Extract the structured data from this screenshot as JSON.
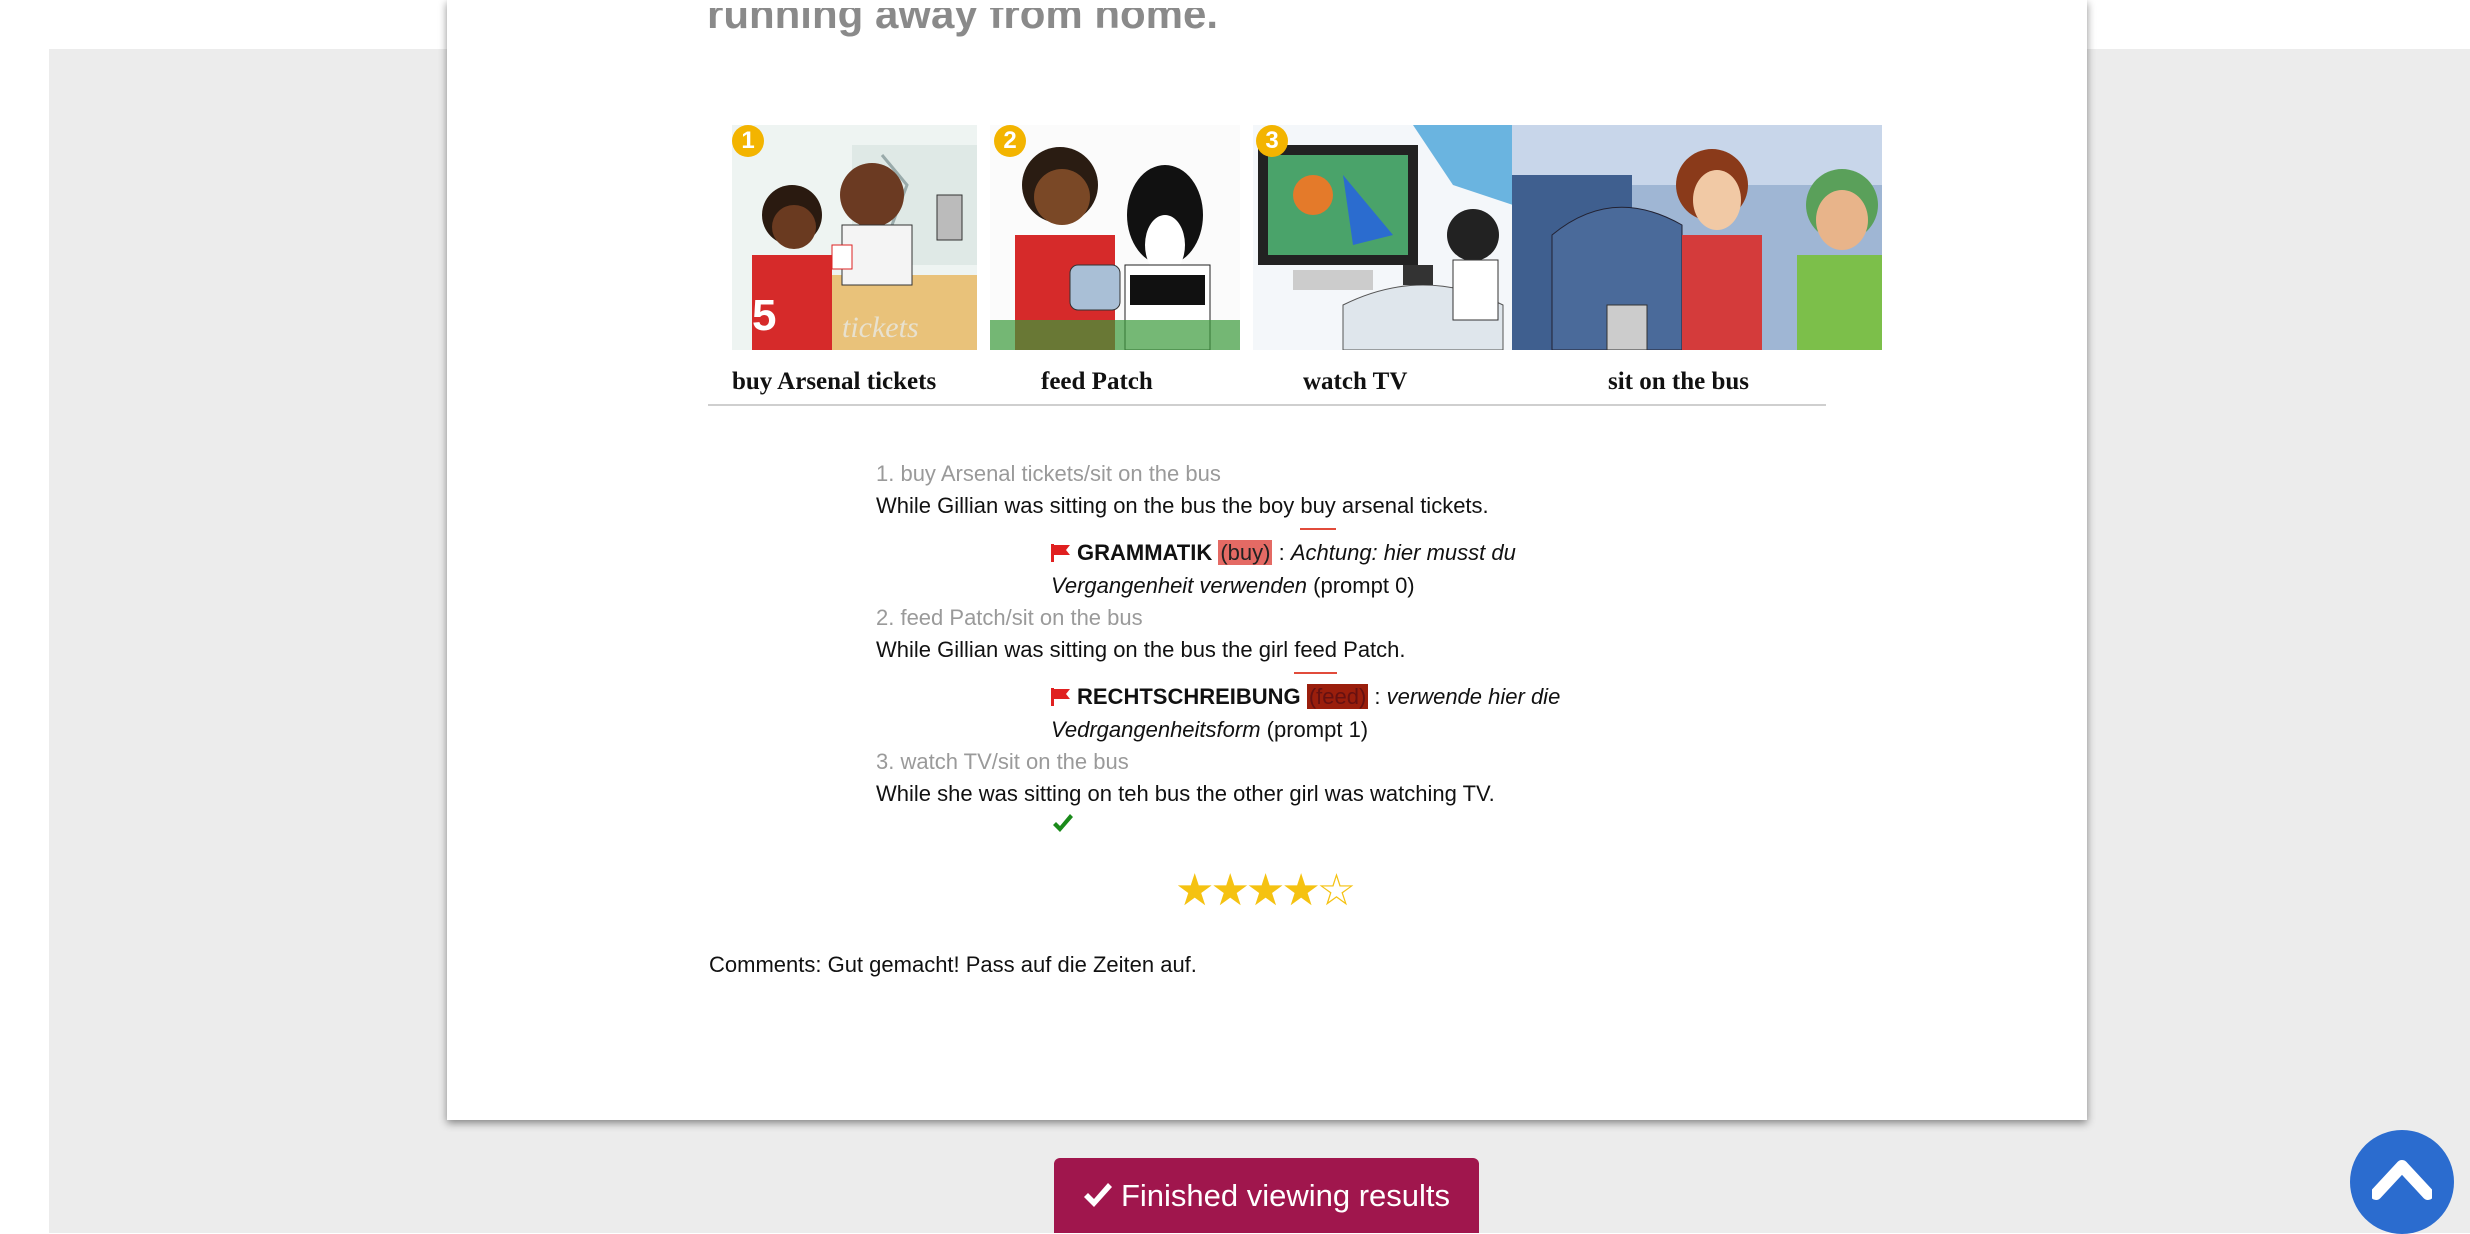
{
  "worksheet": {
    "cut_title": "running away from home."
  },
  "strip": {
    "panels": [
      {
        "number": "1",
        "caption": "buy Arsenal tickets",
        "icon": "ticket-counter-illustration"
      },
      {
        "number": "2",
        "caption": "feed Patch",
        "icon": "dog-feeding-illustration"
      },
      {
        "number": "3",
        "caption": "watch TV",
        "icon": "tv-watching-illustration"
      },
      {
        "number": "",
        "caption": "sit on the bus",
        "icon": "bus-passengers-illustration"
      }
    ]
  },
  "answers": [
    {
      "prompt": "1. buy Arsenal tickets/sit on the bus",
      "text_before": "While Gillian was sitting on the bus the boy ",
      "marked": "buy",
      "text_after": " arsenal tickets.",
      "feedback": {
        "type": "GRAMMATIK",
        "highlight": "(buy)",
        "separator": " : ",
        "note": "Achtung: hier musst du Vergangenheit verwenden",
        "suffix": " (prompt 0)"
      }
    },
    {
      "prompt": "2. feed Patch/sit on the bus",
      "text_before": "While Gillian was sitting on the bus the girl ",
      "marked": "feed",
      "text_after": " Patch.",
      "feedback": {
        "type": "RECHTSCHREIBUNG",
        "highlight": "(feed)",
        "separator": " : ",
        "note": "verwende hier die Vedrgangenheitsform",
        "suffix": " (prompt 1)"
      }
    },
    {
      "prompt": "3. watch TV/sit on the bus",
      "text": "While she was sitting on teh bus the other girl was watching TV."
    }
  ],
  "rating": {
    "stars_display": "★★★★☆",
    "value": 4,
    "max": 5
  },
  "comments": "Comments: Gut gemacht! Pass auf die Zeiten auf.",
  "buttons": {
    "finish_label": "Finished viewing results"
  },
  "colors": {
    "accent": "#a0164d",
    "scroll_button": "#2b6ccf",
    "star": "#f5c211",
    "flag": "#e02020",
    "check": "#1a8a1a"
  }
}
